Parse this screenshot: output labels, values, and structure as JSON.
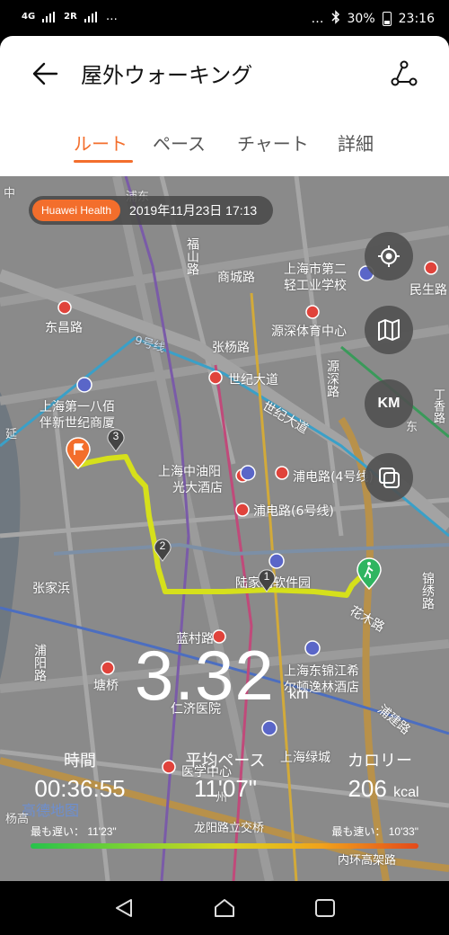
{
  "status_bar": {
    "network_type": "4G",
    "sim_tag": "2R",
    "dots_left": "…",
    "dots_right": "…",
    "bluetooth_icon": "bluetooth-icon",
    "battery": "30%",
    "time": "23:16"
  },
  "header": {
    "title": "屋外ウォーキング",
    "back_icon": "back-arrow-icon",
    "route_icon": "route-share-icon",
    "tabs": [
      {
        "label": "ルート",
        "active": true
      },
      {
        "label": "ペース",
        "active": false
      },
      {
        "label": "チャート",
        "active": false
      },
      {
        "label": "詳細",
        "active": false
      }
    ]
  },
  "map": {
    "badge": "Huawei Health",
    "date": "2019年11月23日 17:13",
    "labels": {
      "l1": "东昌路",
      "l2": "上海第一八佰",
      "l3": "伴新世纪商厦",
      "l4": "张家浜",
      "l5": "福山路",
      "l6": "商城路",
      "l7": "上海市第二",
      "l8": "轻工业学校",
      "l9": "民生路",
      "l10": "源深体育中心",
      "l11": "张杨路",
      "l12": "世纪大道",
      "l13": "世纪大道",
      "l14": "源深路",
      "l15": "上海中油阳",
      "l16": "光大酒店",
      "l17": "浦电路(4号线)",
      "l18": "浦电路(6号线)",
      "l19": "陆家嘴软件园",
      "l20": "花木路",
      "l21": "锦绣路",
      "l22": "蓝村路",
      "l23": "塘桥",
      "l24": "浦阳路",
      "l25": "仁济医院",
      "l26": "上海东锦江希",
      "l27": "尔顿逸林酒店",
      "l28": "浦建路",
      "l29": "上海绿城",
      "l30": "医学中心",
      "l31": "龙阳路立交桥",
      "l32": "内环高架路",
      "l33": "高德地图",
      "l34": "9号线",
      "l35": "浦东",
      "l36": "丁香路",
      "l37": "延",
      "l38": "杨高",
      "l39": "东",
      "l40": "中",
      "l41": "州"
    },
    "markers": [
      "1",
      "2",
      "3"
    ],
    "controls": {
      "locate_icon": "locate-icon",
      "map_icon": "map-layers-icon",
      "unit_label": "KM",
      "layers_icon": "layers-toggle-icon"
    }
  },
  "summary": {
    "distance": "3.32",
    "distance_unit": "km",
    "stats": [
      {
        "label": "時間",
        "value": "00:36:55",
        "unit": ""
      },
      {
        "label": "平均ペース",
        "value": "11'07\"",
        "unit": ""
      },
      {
        "label": "カロリー",
        "value": "206",
        "unit": "kcal"
      }
    ],
    "pace_slowest": "最も遅い： 11'23\"",
    "pace_fastest": "最も速い： 10'33\""
  },
  "colors": {
    "accent": "#f36e2c",
    "route": "#d6e01b",
    "map_bg": "#8a8a8a"
  },
  "navbar": {
    "back_icon": "nav-back-icon",
    "home_icon": "nav-home-icon",
    "recents_icon": "nav-recents-icon"
  }
}
